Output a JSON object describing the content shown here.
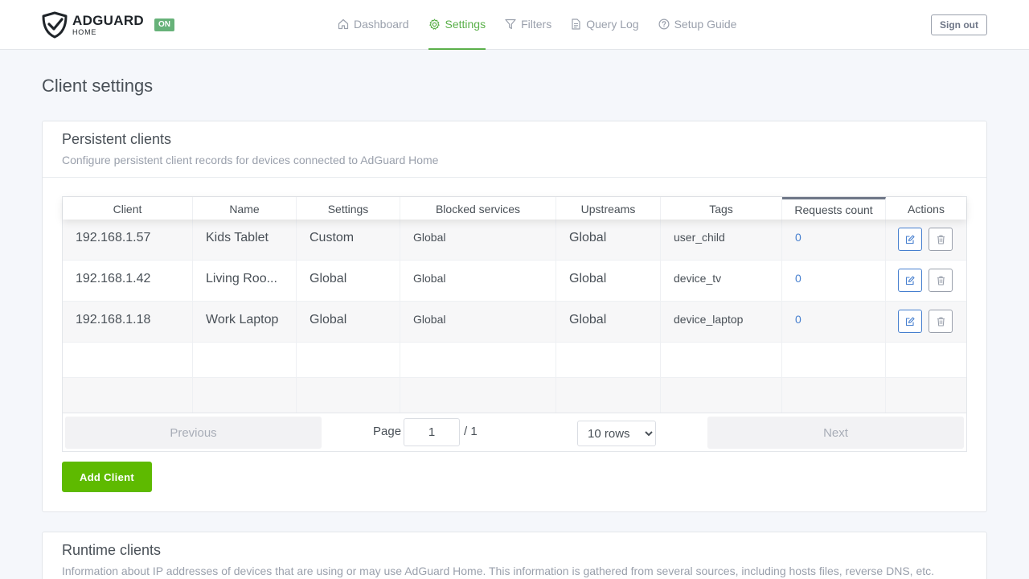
{
  "brand": {
    "name": "ADGUARD",
    "sub": "HOME",
    "status": "ON",
    "accent": "#5bb04a"
  },
  "nav": [
    {
      "label": "Dashboard",
      "icon": "home-icon",
      "active": false
    },
    {
      "label": "Settings",
      "icon": "gear-icon",
      "active": true
    },
    {
      "label": "Filters",
      "icon": "filter-icon",
      "active": false
    },
    {
      "label": "Query Log",
      "icon": "document-icon",
      "active": false
    },
    {
      "label": "Setup Guide",
      "icon": "help-circle-icon",
      "active": false
    }
  ],
  "header": {
    "signout_label": "Sign out"
  },
  "page": {
    "title": "Client settings"
  },
  "persistent": {
    "title": "Persistent clients",
    "subtitle": "Configure persistent client records for devices connected to AdGuard Home",
    "columns": [
      "Client",
      "Name",
      "Settings",
      "Blocked services",
      "Upstreams",
      "Tags",
      "Requests count",
      "Actions"
    ],
    "sorted_column": "Requests count",
    "rows": [
      {
        "client": "192.168.1.57",
        "name": "Kids Tablet",
        "settings": "Custom",
        "blocked": "Global",
        "upstreams": "Global",
        "tags": "user_child",
        "requests": "0"
      },
      {
        "client": "192.168.1.42",
        "name": "Living Roo...",
        "settings": "Global",
        "blocked": "Global",
        "upstreams": "Global",
        "tags": "device_tv",
        "requests": "0"
      },
      {
        "client": "192.168.1.18",
        "name": "Work Laptop",
        "settings": "Global",
        "blocked": "Global",
        "upstreams": "Global",
        "tags": "device_laptop",
        "requests": "0"
      }
    ],
    "pagination": {
      "previous_label": "Previous",
      "next_label": "Next",
      "page_label": "Page",
      "page_value": "1",
      "total_label": "/ 1",
      "rows_options": [
        "10 rows"
      ],
      "rows_selected": "10 rows"
    },
    "add_label": "Add Client"
  },
  "runtime": {
    "title": "Runtime clients",
    "subtitle": "Information about IP addresses of devices that are using or may use AdGuard Home. This information is gathered from several sources, including hosts files, reverse DNS, etc."
  }
}
